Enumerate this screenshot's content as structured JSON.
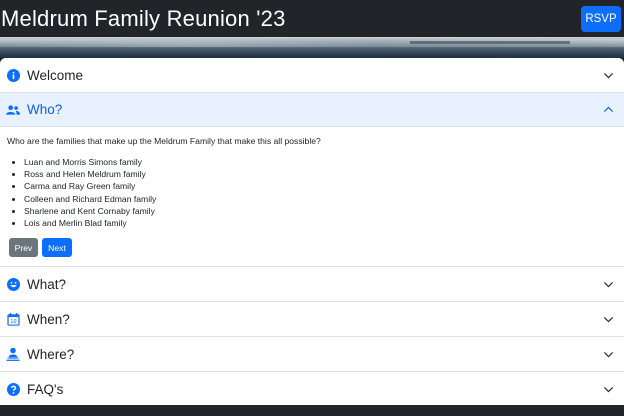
{
  "navbar": {
    "title": "Meldrum Family Reunion '23",
    "rsvp_label": "RSVP"
  },
  "colors": {
    "primary": "#0d6efd",
    "secondary": "#6c757d",
    "active_header_bg": "#e7f1ff",
    "navbar_bg": "#212529"
  },
  "accordion": {
    "welcome": {
      "title": "Welcome",
      "icon": "info-circle-icon"
    },
    "who": {
      "title": "Who?",
      "icon": "people-icon",
      "intro": "Who are the families that make up the Meldrum Family that make this all possible?",
      "families": [
        "Luan and Morris Simons family",
        "Ross and Helen Meldrum family",
        "Carma and Ray Green family",
        "Colleen and Richard Edman family",
        "Sharlene and Kent Cornaby family",
        "Lois and Merlin Blad family"
      ],
      "prev_label": "Prev",
      "next_label": "Next"
    },
    "what": {
      "title": "What?",
      "icon": "smile-icon"
    },
    "when": {
      "title": "When?",
      "icon": "calendar-icon",
      "calendar_day": "10"
    },
    "where": {
      "title": "Where?",
      "icon": "person-location-icon"
    },
    "faq": {
      "title": "FAQ's",
      "icon": "question-circle-icon"
    }
  }
}
